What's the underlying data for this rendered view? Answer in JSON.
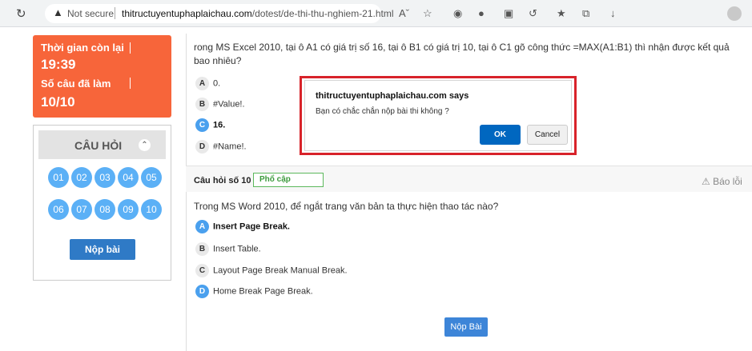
{
  "browser": {
    "security_label": "Not secure",
    "url_domain": "thitructuyentuphaplaichau.com",
    "url_path": "/dotest/de-thi-thu-nghiem-21.html"
  },
  "timer": {
    "time_label": "Thời gian còn lại",
    "time_value": "19:39",
    "done_label": "Số câu đã làm",
    "done_value": "10/10"
  },
  "questions_panel": {
    "title": "CÂU HỎI",
    "numbers": [
      "01",
      "02",
      "03",
      "04",
      "05",
      "06",
      "07",
      "08",
      "09",
      "10"
    ],
    "submit_label": "Nộp bài"
  },
  "question9": {
    "text": "rong MS Excel 2010, tại ô A1 có giá trị số 16, tại ô B1 có giá trị 10, tại ô C1 gõ công thức =MAX(A1:B1) thì nhận được kết quả bao nhiêu?",
    "options": [
      {
        "letter": "A",
        "text": "0."
      },
      {
        "letter": "B",
        "text": "#Value!."
      },
      {
        "letter": "C",
        "text": "16."
      },
      {
        "letter": "D",
        "text": "#Name!."
      }
    ]
  },
  "question10": {
    "title": "Câu hỏi số 10",
    "tag": "Phổ cập",
    "report": "Báo lỗi",
    "text": "Trong MS Word 2010, để ngắt trang văn bản ta thực hiện thao tác nào?",
    "options": [
      {
        "letter": "A",
        "text": "Insert Page Break."
      },
      {
        "letter": "B",
        "text": "Insert Table."
      },
      {
        "letter": "C",
        "text": "Layout Page Break Manual Break."
      },
      {
        "letter": "D",
        "text": "Home Break Page Break."
      }
    ]
  },
  "submit_bottom": "Nộp Bài",
  "dialog": {
    "title": "thitructuyentuphaplaichau.com says",
    "message": "Bạn có chắc chắn nộp bài thi không ?",
    "ok": "OK",
    "cancel": "Cancel"
  },
  "colors": {
    "timer_bg": "#f7653a",
    "number_bubble": "#5bb0f6",
    "primary_button": "#2f7ac6",
    "dialog_highlight": "#d8232a"
  }
}
